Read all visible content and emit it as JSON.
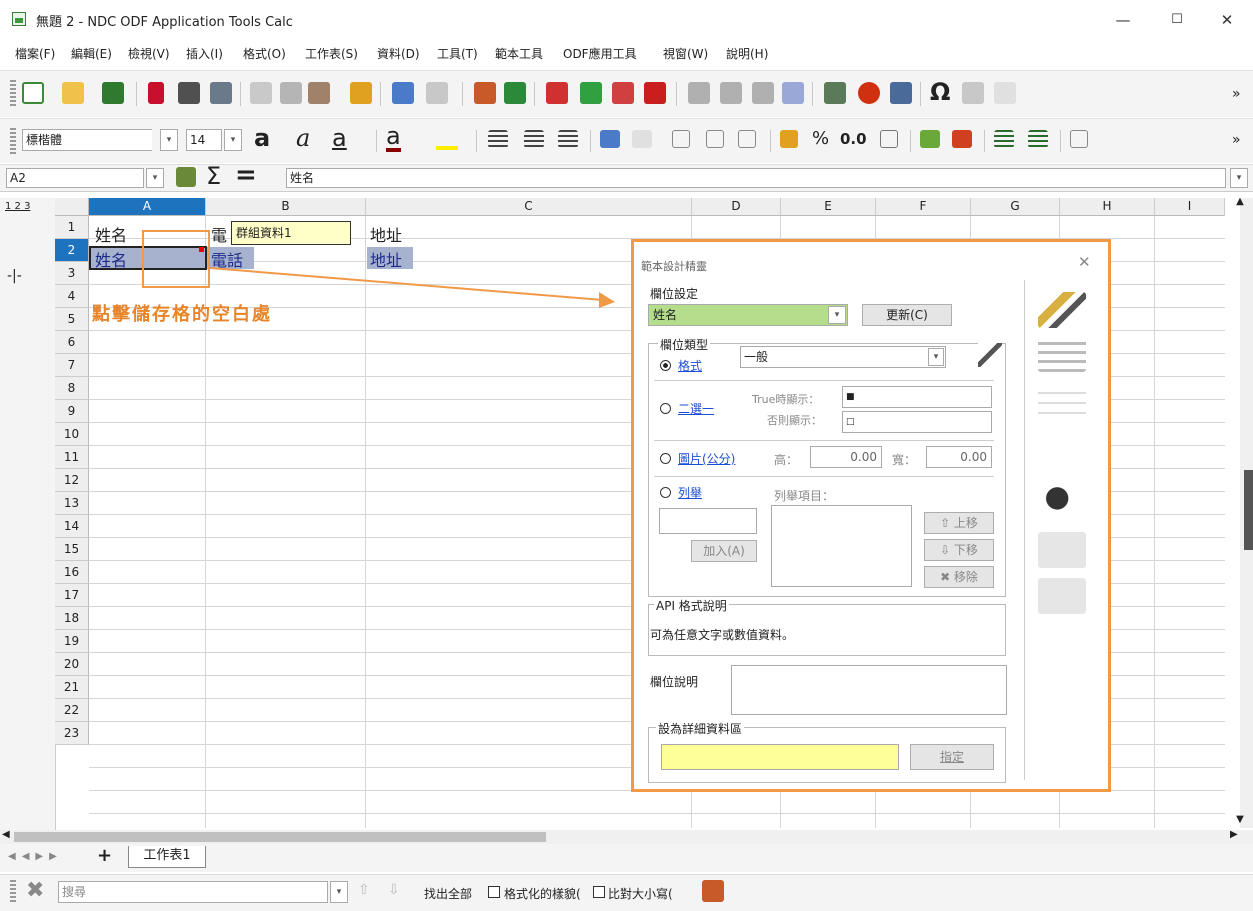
{
  "window": {
    "title": "無題 2 - NDC ODF Application Tools Calc",
    "min": "—",
    "max": "☐",
    "close": "✕"
  },
  "menu": [
    "檔案(F)",
    "編輯(E)",
    "檢視(V)",
    "插入(I)",
    "格式(O)",
    "工作表(S)",
    "資料(D)",
    "工具(T)",
    "範本工具",
    "ODF應用工具",
    "視窗(W)",
    "說明(H)"
  ],
  "format": {
    "font": "標楷體",
    "size": "14",
    "percent": "%",
    "decimal": "0.0",
    "overflow": "»"
  },
  "formula": {
    "cellref": "A2",
    "sum": "Σ",
    "equals": "=",
    "content": "姓名"
  },
  "outline": {
    "levels": "1 2 3",
    "group": "-|-"
  },
  "columns": [
    "A",
    "B",
    "C",
    "D",
    "E",
    "F",
    "G",
    "H",
    "I"
  ],
  "rows": [
    "1",
    "2",
    "3",
    "4",
    "5",
    "6",
    "7",
    "8",
    "9",
    "10",
    "11",
    "12",
    "13",
    "14",
    "15",
    "16",
    "17",
    "18",
    "19",
    "20",
    "21",
    "22",
    "23"
  ],
  "cells": {
    "a1": "姓名",
    "b1": "電",
    "tooltip": "群組資料1",
    "c1": "地址",
    "a2": "姓名",
    "b2": "電話",
    "c2": "地址",
    "hint": "點擊儲存格的空白處"
  },
  "dialog": {
    "title": "範本設計精靈",
    "close": "✕",
    "field_setting": "欄位設定",
    "field_value": "姓名",
    "update": "更新(C)",
    "field_type": "欄位類型",
    "fmt": "格式",
    "fmt_value": "一般",
    "binary": "二選一",
    "true_show": "True時顯示：",
    "true_val": "■",
    "false_show": "否則顯示：",
    "false_val": "□",
    "image": "圖片(公分)",
    "height": "高：",
    "height_val": "0.00",
    "width": "寬：",
    "width_val": "0.00",
    "list": "列舉",
    "list_items": "列舉項目：",
    "add": "加入(A)",
    "up": "⇧ 上移",
    "down": "⇩ 下移",
    "remove": "✖ 移除",
    "api_title": "API 格式說明",
    "api_text": "可為任意文字或數值資料。",
    "field_desc": "欄位說明",
    "detail": "設為詳細資料區",
    "assign": "指定"
  },
  "sheets": {
    "add": "+",
    "tab": "工作表1"
  },
  "find": {
    "placeholder": "搜尋",
    "find_all": "找出全部",
    "formatted": "格式化的樣貌(",
    "match_case": "比對大小寫("
  },
  "colors": {
    "accent": "#f09a48",
    "selection": "#1e73be",
    "highlight_green": "#b4dd8c",
    "highlight_yellow": "#ffff99"
  }
}
